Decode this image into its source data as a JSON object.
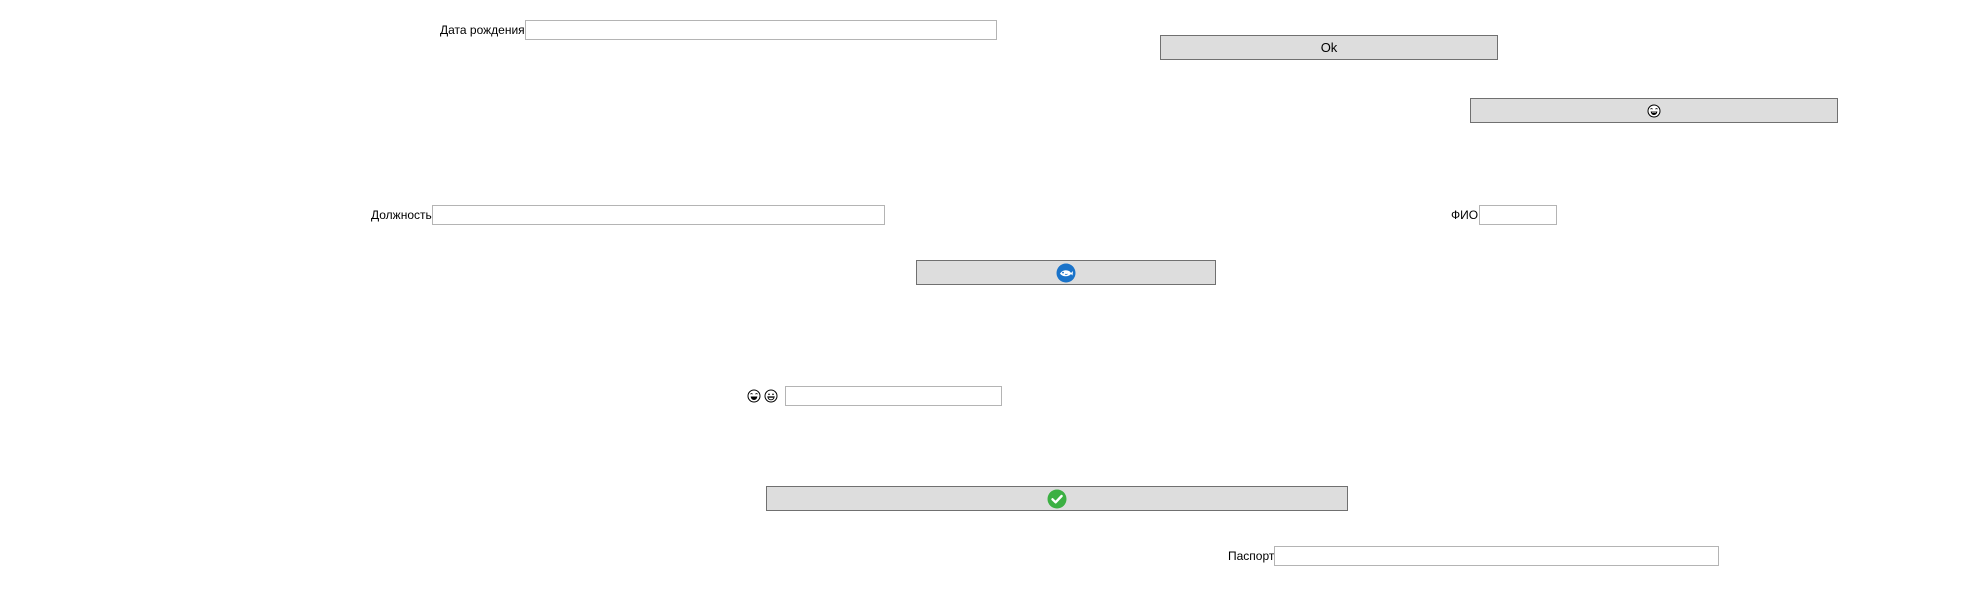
{
  "form": {
    "birth_date_label": "Дата рождения",
    "birth_date_value": "",
    "position_label": "Должность",
    "position_value": "",
    "fio_label": "ФИО",
    "fio_value": "",
    "passport_label": "Паспорт",
    "passport_value": "",
    "emoji_field_value": ""
  },
  "buttons": {
    "ok_label": "Ok",
    "laugh_button_icon": "laughing-face-icon",
    "fish_button_icon": "blue-fish-icon",
    "check_button_icon": "green-check-icon"
  },
  "colors": {
    "button_bg": "#dddddd",
    "button_border": "#707070",
    "field_border": "#b4b4b4",
    "fish_blue": "#1a73c9",
    "check_green": "#3cb043"
  }
}
